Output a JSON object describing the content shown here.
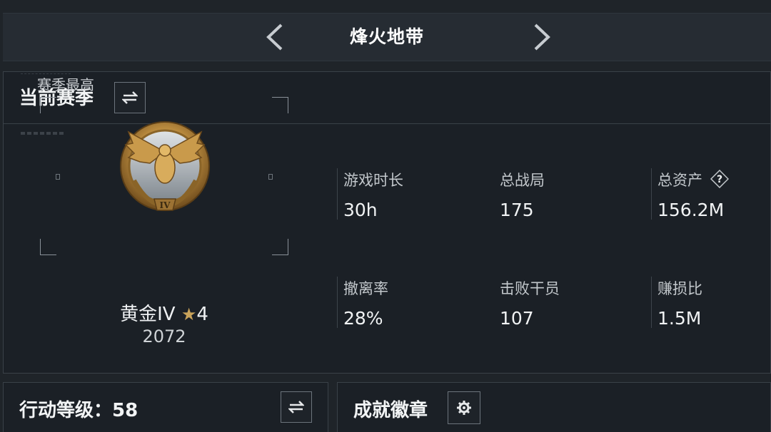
{
  "header": {
    "title": "烽火地带",
    "prev_icon": "chevron-left-icon",
    "next_icon": "chevron-right-icon"
  },
  "season": {
    "title": "当前赛季",
    "swap_icon": "swap-icon",
    "best_label": "赛季最高",
    "rank": {
      "name": "黄金IV",
      "star_icon": "star-icon",
      "stars": "4",
      "score": "2072",
      "emblem_numeral": "IV"
    },
    "stats": [
      {
        "label": "游戏时长",
        "value": "30h"
      },
      {
        "label": "总战局",
        "value": "175"
      },
      {
        "label": "总资产",
        "value": "156.2M",
        "help": "?"
      },
      {
        "label": "撤离率",
        "value": "28%"
      },
      {
        "label": "击败干员",
        "value": "107"
      },
      {
        "label": "赚损比",
        "value": "1.5M"
      }
    ]
  },
  "action_level": {
    "title": "行动等级：58",
    "swap_icon": "swap-icon"
  },
  "achievements": {
    "title": "成就徽章",
    "gear_icon": "gear-icon"
  },
  "colors": {
    "background": "#1f2429",
    "panel": "#1b2026",
    "border": "#3a4148",
    "gold": "#c9a35a",
    "text": "#f1f3f4"
  }
}
